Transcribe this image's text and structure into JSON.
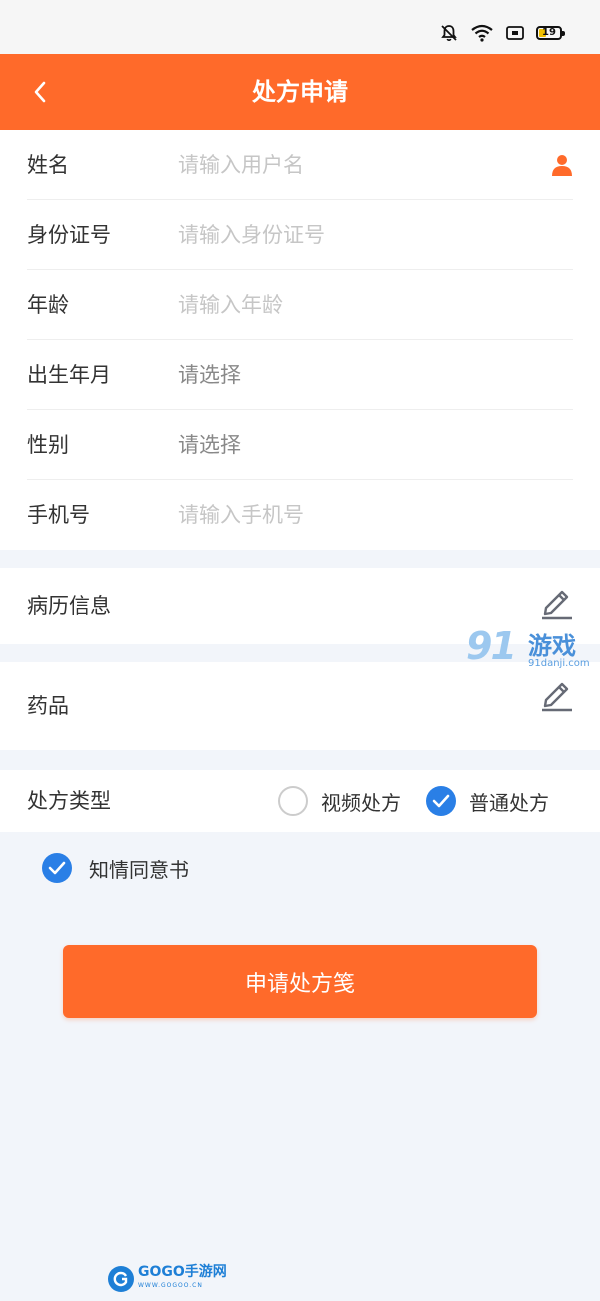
{
  "nav": {
    "title": "处方申请"
  },
  "form": {
    "fields": [
      {
        "label": "姓名",
        "placeholder": "请输入用户名"
      },
      {
        "label": "身份证号",
        "placeholder": "请输入身份证号"
      },
      {
        "label": "年龄",
        "placeholder": "请输入年龄"
      },
      {
        "label": "出生年月",
        "value": "请选择"
      },
      {
        "label": "性别",
        "value": "请选择"
      },
      {
        "label": "手机号",
        "placeholder": "请输入手机号"
      }
    ]
  },
  "medical_record": {
    "label": "病历信息"
  },
  "medicine": {
    "label": "药品"
  },
  "prescription_type": {
    "label": "处方类型",
    "options": [
      {
        "label": "视频处方",
        "checked": false
      },
      {
        "label": "普通处方",
        "checked": true
      }
    ]
  },
  "consent": {
    "label": "知情同意书",
    "checked": true
  },
  "submit": {
    "label": "申请处方笺"
  },
  "status_bar": {
    "battery": "19"
  },
  "watermarks": {
    "top_number": "91",
    "top_name": "游戏",
    "top_url": "91danji.com",
    "bottom_name": "GOGO手游网",
    "bottom_url": "WWW.GOGOO.CN"
  },
  "colors": {
    "brand": "#ff6a2a",
    "check": "#2a7fe6",
    "background": "#f2f5fa"
  }
}
